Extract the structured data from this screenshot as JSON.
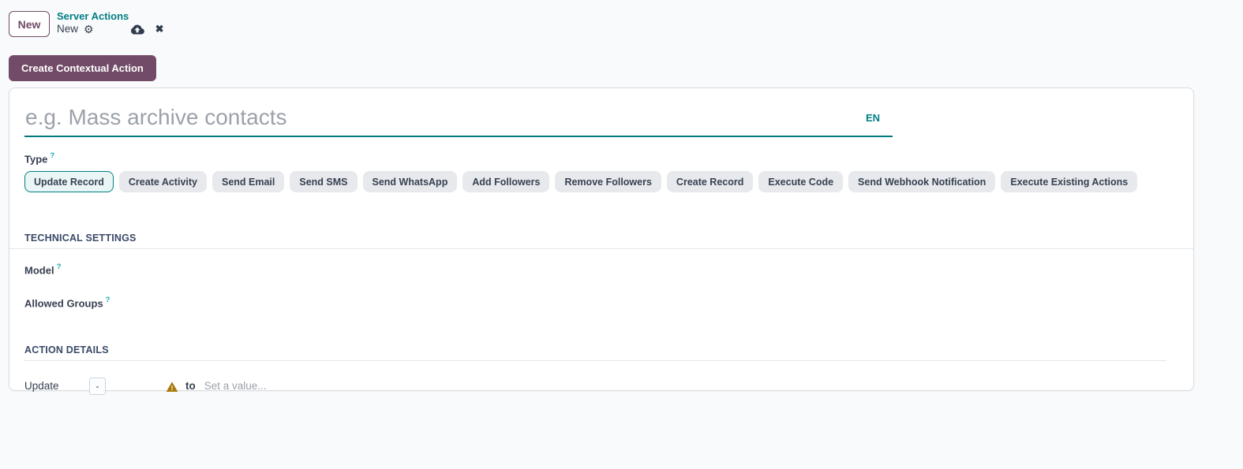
{
  "colors": {
    "brand_purple": "#714B67",
    "accent_teal": "#017E84",
    "warning": "#a87b0c",
    "muted_text": "#9ca1aa",
    "page_background": "#f9fafb"
  },
  "breadcrumb": {
    "status_badge": "New",
    "parent": "Server Actions",
    "current": "New",
    "gear_icon": "⚙",
    "close_icon": "✖"
  },
  "toolbar": {
    "create_contextual_action_label": "Create Contextual Action"
  },
  "form": {
    "title": {
      "value": "",
      "placeholder": "e.g. Mass archive contacts",
      "lang_badge": "EN"
    },
    "type": {
      "label": "Type",
      "help_marker": "?",
      "selected": "Update Record",
      "options": [
        "Update Record",
        "Create Activity",
        "Send Email",
        "Send SMS",
        "Send WhatsApp",
        "Add Followers",
        "Remove Followers",
        "Create Record",
        "Execute Code",
        "Send Webhook Notification",
        "Execute Existing Actions"
      ]
    },
    "sections": {
      "technical_settings": "TECHNICAL SETTINGS",
      "action_details": "ACTION DETAILS"
    },
    "fields": {
      "model": {
        "label": "Model",
        "help_marker": "?",
        "value": ""
      },
      "allowed_groups": {
        "label": "Allowed Groups",
        "help_marker": "?",
        "value": ""
      }
    },
    "update_line": {
      "label": "Update",
      "field_selector_value": "-",
      "to_label": "to",
      "value_placeholder": "Set a value..."
    }
  }
}
